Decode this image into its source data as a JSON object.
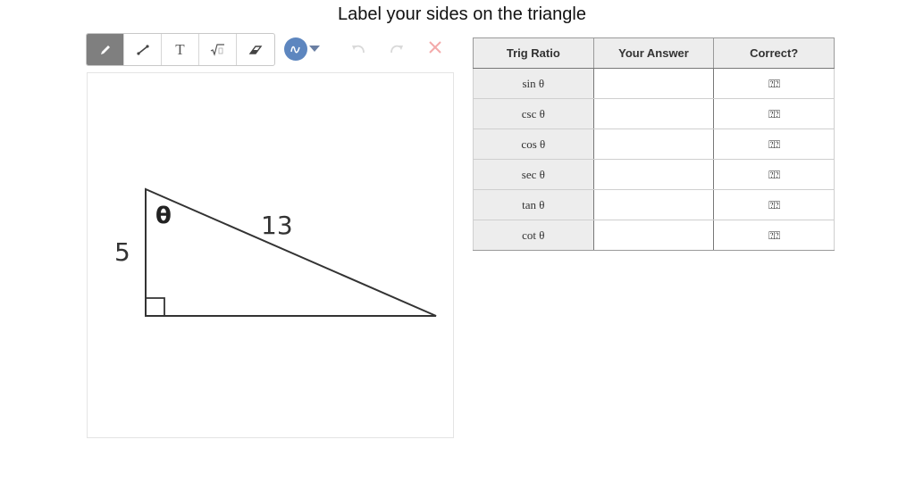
{
  "page_title": "Label your sides on the triangle",
  "toolbar": {
    "tools": [
      {
        "name": "pencil-icon",
        "glyph": "✎"
      },
      {
        "name": "line-icon",
        "glyph": "⟋"
      },
      {
        "name": "text-tool-icon",
        "glyph": "T"
      },
      {
        "name": "sqrt-icon",
        "glyph": "√▫"
      },
      {
        "name": "eraser-icon",
        "glyph": "⌫"
      }
    ],
    "active_tool": "pencil-icon",
    "color": "#5d86bf",
    "undo_icon": "undo-icon",
    "redo_icon": "redo-icon",
    "clear_icon": "close-icon"
  },
  "drawing": {
    "side_label_vertical": "5",
    "side_label_hypotenuse": "13",
    "angle_label": "θ"
  },
  "table": {
    "headers": [
      "Trig Ratio",
      "Your Answer",
      "Correct?"
    ],
    "rows": [
      {
        "ratio": "sin θ",
        "answer": "",
        "correct": "⍰⍰"
      },
      {
        "ratio": "csc θ",
        "answer": "",
        "correct": "⍰⍰"
      },
      {
        "ratio": "cos θ",
        "answer": "",
        "correct": "⍰⍰"
      },
      {
        "ratio": "sec θ",
        "answer": "",
        "correct": "⍰⍰"
      },
      {
        "ratio": "tan θ",
        "answer": "",
        "correct": "⍰⍰"
      },
      {
        "ratio": "cot θ",
        "answer": "",
        "correct": "⍰⍰"
      }
    ]
  }
}
